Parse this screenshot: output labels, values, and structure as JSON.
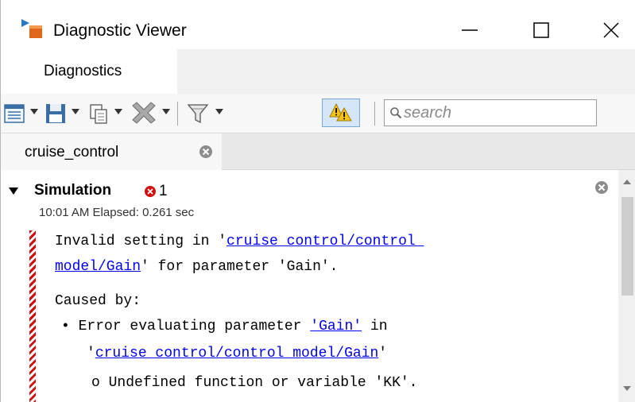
{
  "window": {
    "title": "Diagnostic Viewer"
  },
  "tabs": [
    {
      "label": "Diagnostics",
      "active": true
    }
  ],
  "toolbar": {
    "icons": [
      "table-view-icon",
      "save-icon",
      "copy-icon",
      "clear-icon",
      "filter-icon",
      "warning-toggle-icon"
    ],
    "search_placeholder": "search"
  },
  "source_tab": {
    "label": "cruise_control"
  },
  "diagnostic": {
    "title": "Simulation",
    "error_count": "1",
    "timestamp": "10:01 AM   Elapsed: 0.261 sec",
    "line1_prefix": "Invalid setting in '",
    "line1_link": "cruise control/control ",
    "line2_link": "model/Gain",
    "line2_suffix": "' for parameter 'Gain'.",
    "caused_by": "Caused by:",
    "bullet1_prefix": "Error evaluating parameter ",
    "bullet1_link": "'Gain'",
    "bullet1_suffix": " in",
    "bullet1_line2_quote_open": "'",
    "bullet1_line2_link": "cruise control/control model/Gain",
    "bullet1_line2_quote_close": "'",
    "sub_bullet": "Undefined function or variable 'KK'."
  },
  "colors": {
    "error_red": "#d10f0f",
    "link_blue": "#0000ee",
    "warning_toggle_bg": "#d4e6f7"
  }
}
